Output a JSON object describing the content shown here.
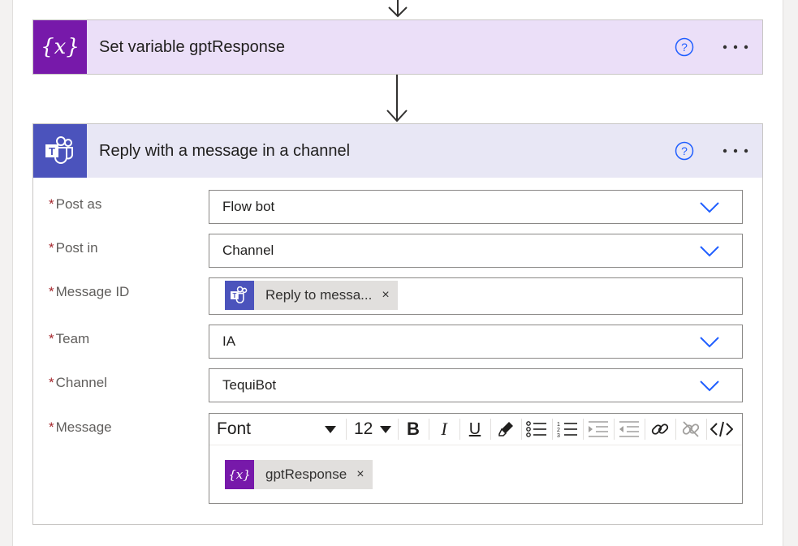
{
  "colors": {
    "variable_purple": "#7719aa",
    "teams_indigo": "#4b53bc",
    "variable_header_bg": "#ebdff8",
    "teams_header_bg": "#e8e7f5",
    "accent_blue": "#1f5eff",
    "required_red": "#a4262c"
  },
  "variable_card": {
    "icon": "variable-icon",
    "icon_text": "{x}",
    "title": "Set variable gptResponse"
  },
  "teams_card": {
    "icon": "teams-icon",
    "title": "Reply with a message in a channel",
    "fields": {
      "post_as": {
        "label": "Post as",
        "value": "Flow bot"
      },
      "post_in": {
        "label": "Post in",
        "value": "Channel"
      },
      "message_id": {
        "label": "Message ID",
        "token": "Reply to messa...",
        "token_close": "×"
      },
      "team": {
        "label": "Team",
        "value": "IA"
      },
      "channel": {
        "label": "Channel",
        "value": "TequiBot"
      },
      "message": {
        "label": "Message",
        "toolbar": {
          "font": "Font",
          "size": "12",
          "bold": "B",
          "italic": "I",
          "underline": "U"
        },
        "token": "gptResponse",
        "token_close": "×"
      }
    },
    "required_marker": "*"
  }
}
